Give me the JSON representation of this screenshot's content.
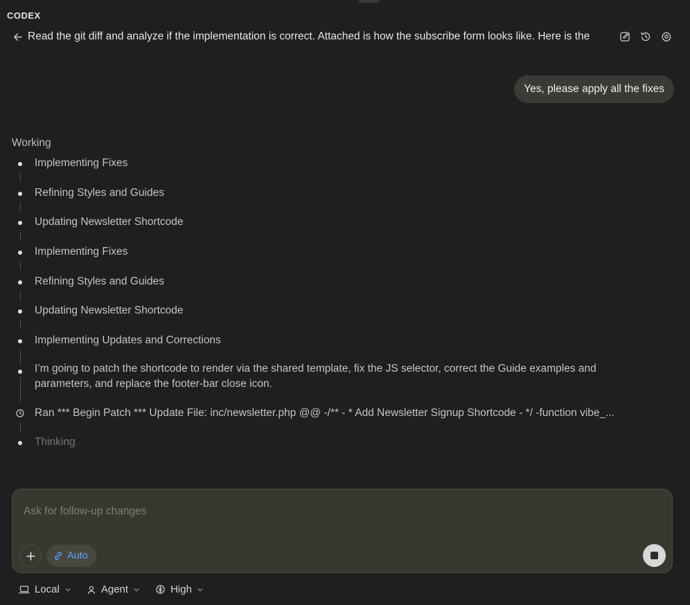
{
  "app": {
    "title": "CODEX"
  },
  "header": {
    "thread_title": "Read the git diff and analyze if the implementation is correct. Attached is how the subscribe form looks like. Here is the",
    "icons": [
      "back-arrow-icon",
      "edit-icon",
      "history-icon",
      "gear-icon"
    ]
  },
  "chat": {
    "user_message": "Yes, please apply all the fixes",
    "status": "Working",
    "steps": [
      {
        "type": "dot",
        "text": "Implementing Fixes"
      },
      {
        "type": "dot",
        "text": "Refining Styles and Guides"
      },
      {
        "type": "dot",
        "text": "Updating Newsletter Shortcode"
      },
      {
        "type": "dot",
        "text": "Implementing Fixes"
      },
      {
        "type": "dot",
        "text": "Refining Styles and Guides"
      },
      {
        "type": "dot",
        "text": "Updating Newsletter Shortcode"
      },
      {
        "type": "dot",
        "text": "Implementing Updates and Corrections"
      },
      {
        "type": "dot",
        "text": "I’m going to patch the shortcode to render via the shared template, fix the JS selector, correct the Guide examples and parameters, and replace the footer-bar close icon."
      },
      {
        "type": "clock",
        "text": "Ran *** Begin Patch *** Update File: inc/newsletter.php @@ -/** - * Add Newsletter Signup Shortcode - */ -function vibe_..."
      },
      {
        "type": "dot",
        "text": "Thinking"
      }
    ]
  },
  "composer": {
    "placeholder": "Ask for follow-up changes",
    "value": "",
    "mode_label": "Auto",
    "accent": "#5aa7ff"
  },
  "footer": {
    "location": "Local",
    "agent": "Agent",
    "reasoning": "High"
  }
}
